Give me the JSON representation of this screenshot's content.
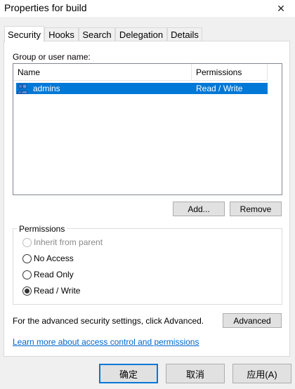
{
  "window": {
    "title": "Properties for build",
    "close_glyph": "✕"
  },
  "tabs": [
    {
      "label": "Security",
      "active": true
    },
    {
      "label": "Hooks",
      "active": false
    },
    {
      "label": "Search",
      "active": false
    },
    {
      "label": "Delegation",
      "active": false
    },
    {
      "label": "Details",
      "active": false
    }
  ],
  "security": {
    "group_label": "Group or user name:",
    "columns": {
      "name": "Name",
      "permissions": "Permissions"
    },
    "rows": [
      {
        "name": "admins",
        "permissions": "Read / Write",
        "icon": "user-group-icon",
        "selected": true
      }
    ],
    "add_button": "Add...",
    "remove_button": "Remove",
    "permissions_group_label": "Permissions",
    "options": [
      {
        "label": "Inherit from parent",
        "checked": false,
        "disabled": true
      },
      {
        "label": "No Access",
        "checked": false,
        "disabled": false
      },
      {
        "label": "Read Only",
        "checked": false,
        "disabled": false
      },
      {
        "label": "Read / Write",
        "checked": true,
        "disabled": false
      }
    ],
    "advanced_text": "For the advanced security settings, click Advanced.",
    "advanced_button": "Advanced",
    "help_link": "Learn more about access control and permissions"
  },
  "footer": {
    "ok": "确定",
    "cancel": "取消",
    "apply": "应用(A)"
  },
  "colors": {
    "selection": "#0078d7",
    "link": "#0066cc",
    "default_button_border": "#0078d7"
  }
}
